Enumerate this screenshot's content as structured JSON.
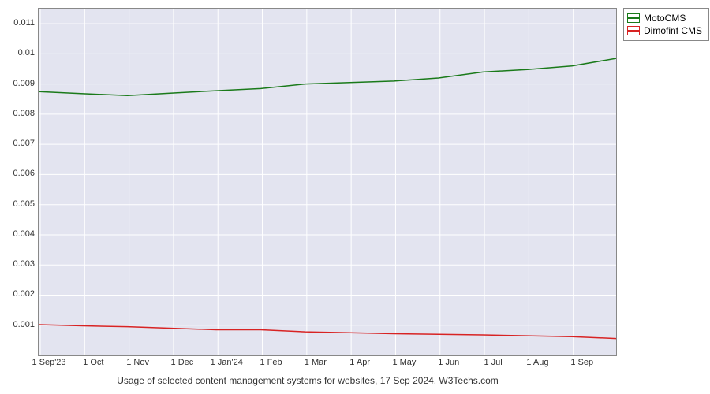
{
  "chart_data": {
    "type": "line",
    "title": "",
    "xlabel": "",
    "ylabel": "",
    "ylim": [
      0,
      0.0115
    ],
    "categories": [
      "1 Sep'23",
      "1 Oct",
      "1 Nov",
      "1 Dec",
      "1 Jan'24",
      "1 Feb",
      "1 Mar",
      "1 Apr",
      "1 May",
      "1 Jun",
      "1 Jul",
      "1 Aug",
      "1 Sep"
    ],
    "y_ticks": [
      0.001,
      0.002,
      0.003,
      0.004,
      0.005,
      0.006,
      0.007,
      0.008,
      0.009,
      0.01,
      0.011
    ],
    "series": [
      {
        "name": "MotoCMS",
        "color": "#1a7a1a",
        "values": [
          0.00875,
          0.00868,
          0.00862,
          0.0087,
          0.00878,
          0.00885,
          0.009,
          0.00905,
          0.0091,
          0.0092,
          0.0094,
          0.00948,
          0.0096,
          0.00985
        ]
      },
      {
        "name": "Dimofinf CMS",
        "color": "#d82323",
        "values": [
          0.00102,
          0.00098,
          0.00095,
          0.0009,
          0.00085,
          0.00085,
          0.00078,
          0.00075,
          0.00072,
          0.0007,
          0.00068,
          0.00065,
          0.00062,
          0.00056
        ]
      }
    ],
    "caption": "Usage of selected content management systems for websites, 17 Sep 2024, W3Techs.com"
  }
}
